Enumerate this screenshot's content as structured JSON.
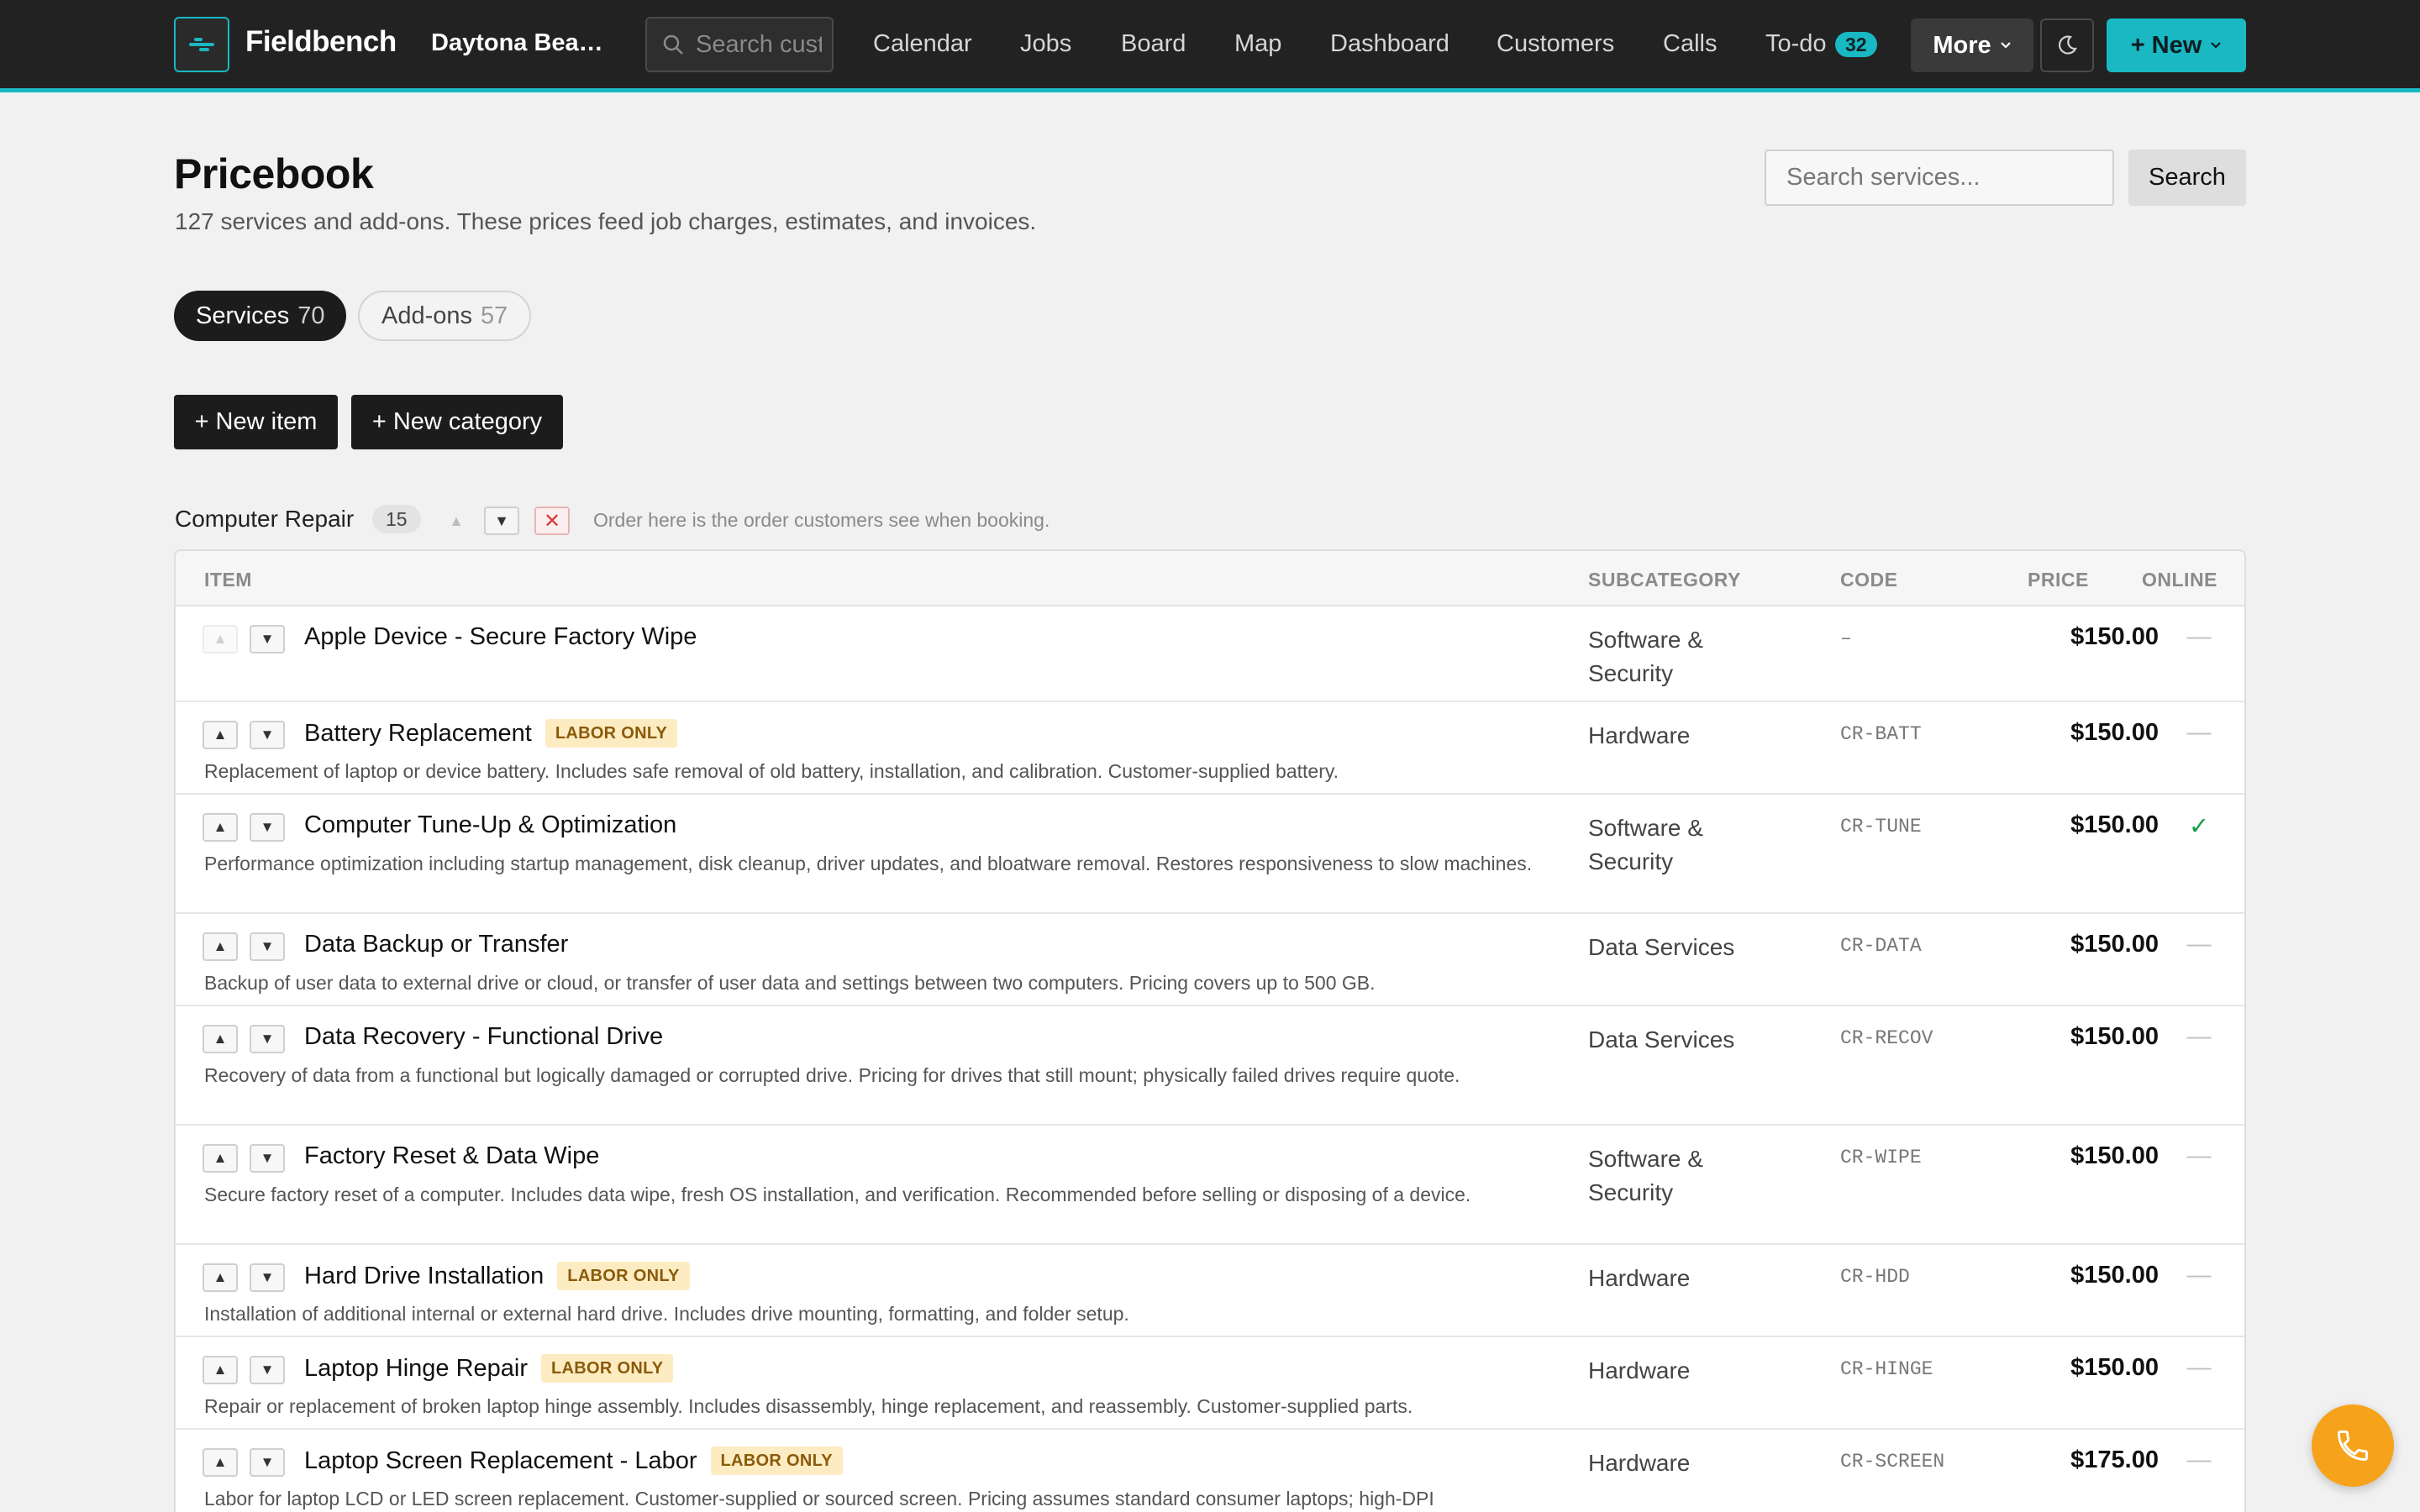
{
  "app": {
    "brand": "Fieldbench",
    "location": "Daytona Beac..."
  },
  "nav": {
    "search_placeholder": "Search customers",
    "links": [
      "Calendar",
      "Jobs",
      "Board",
      "Map",
      "Dashboard",
      "Customers",
      "Calls",
      "To-do"
    ],
    "todo_count": "32",
    "more_label": "More",
    "new_label": "+ New"
  },
  "header": {
    "title": "Pricebook",
    "subtitle": "127 services and add-ons. These prices feed job charges, estimates, and invoices.",
    "search_placeholder": "Search services...",
    "search_button": "Search"
  },
  "tabs": [
    {
      "label": "Services",
      "count": "70",
      "active": true
    },
    {
      "label": "Add-ons",
      "count": "57",
      "active": false
    }
  ],
  "actions": {
    "new_item": "+ New item",
    "new_category": "+ New category"
  },
  "category": {
    "title": "Computer Repair",
    "count": "15",
    "hint": "Order here is the order customers see when booking."
  },
  "table": {
    "columns": {
      "item": "ITEM",
      "subcategory": "SUBCATEGORY",
      "code": "CODE",
      "price": "PRICE",
      "online": "ONLINE"
    },
    "rows": [
      {
        "name": "Apple Device - Secure Factory Wipe",
        "badge": "",
        "desc": "",
        "sub": "Software & Security",
        "code": "–",
        "price": "$150.00",
        "online": "—"
      },
      {
        "name": "Battery Replacement",
        "badge": "LABOR ONLY",
        "desc": "Replacement of laptop or device battery. Includes safe removal of old battery, installation, and calibration. Customer-supplied battery.",
        "sub": "Hardware",
        "code": "CR-BATT",
        "price": "$150.00",
        "online": "—"
      },
      {
        "name": "Computer Tune-Up & Optimization",
        "badge": "",
        "desc": "Performance optimization including startup management, disk cleanup, driver updates, and bloatware removal. Restores responsiveness to slow machines.",
        "sub": "Software & Security",
        "code": "CR-TUNE",
        "price": "$150.00",
        "online": "✓"
      },
      {
        "name": "Data Backup or Transfer",
        "badge": "",
        "desc": "Backup of user data to external drive or cloud, or transfer of user data and settings between two computers. Pricing covers up to 500 GB.",
        "sub": "Data Services",
        "code": "CR-DATA",
        "price": "$150.00",
        "online": "—"
      },
      {
        "name": "Data Recovery - Functional Drive",
        "badge": "",
        "desc": "Recovery of data from a functional but logically damaged or corrupted drive. Pricing for drives that still mount; physically failed drives require quote.",
        "sub": "Data Services",
        "code": "CR-RECOV",
        "price": "$150.00",
        "online": "—"
      },
      {
        "name": "Factory Reset & Data Wipe",
        "badge": "",
        "desc": "Secure factory reset of a computer. Includes data wipe, fresh OS installation, and verification. Recommended before selling or disposing of a device.",
        "sub": "Software & Security",
        "code": "CR-WIPE",
        "price": "$150.00",
        "online": "—"
      },
      {
        "name": "Hard Drive Installation",
        "badge": "LABOR ONLY",
        "desc": "Installation of additional internal or external hard drive. Includes drive mounting, formatting, and folder setup.",
        "sub": "Hardware",
        "code": "CR-HDD",
        "price": "$150.00",
        "online": "—"
      },
      {
        "name": "Laptop Hinge Repair",
        "badge": "LABOR ONLY",
        "desc": "Repair or replacement of broken laptop hinge assembly. Includes disassembly, hinge replacement, and reassembly. Customer-supplied parts.",
        "sub": "Hardware",
        "code": "CR-HINGE",
        "price": "$150.00",
        "online": "—"
      },
      {
        "name": "Laptop Screen Replacement - Labor",
        "badge": "LABOR ONLY",
        "desc": "Labor for laptop LCD or LED screen replacement. Customer-supplied or sourced screen. Pricing assumes standard consumer laptops; high-DPI",
        "sub": "Hardware",
        "code": "CR-SCREEN",
        "price": "$175.00",
        "online": "—"
      }
    ]
  },
  "colors": {
    "accent": "#19b8c2",
    "topbar": "#222222",
    "badge_bg": "#fdecc2",
    "badge_text": "#8a5a0a",
    "online_yes": "#1a9c4a",
    "fab": "#f7a21b"
  },
  "icons": {
    "logo": "bench-logo-icon",
    "search": "search-icon",
    "theme": "moon-icon",
    "phone": "phone-icon"
  }
}
